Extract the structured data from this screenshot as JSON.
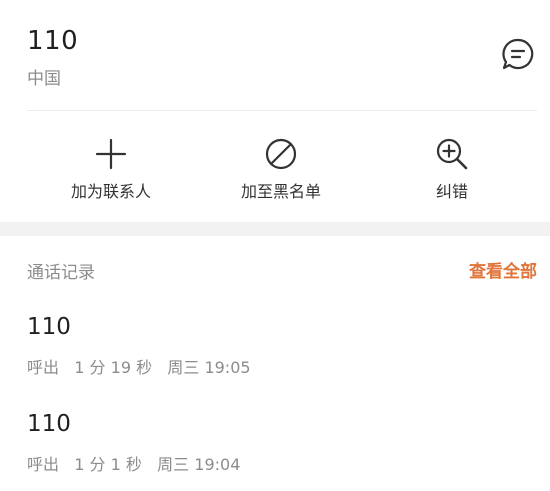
{
  "contact": {
    "number": "110",
    "region": "中国"
  },
  "icons": {
    "message": "message-icon",
    "add_contact": "plus-icon",
    "block": "block-icon",
    "correct": "zoom-in-icon"
  },
  "actions": [
    {
      "label": "加为联系人"
    },
    {
      "label": "加至黑名单"
    },
    {
      "label": "纠错"
    }
  ],
  "call_log": {
    "title": "通话记录",
    "view_all": "查看全部",
    "accent_color": "#e0743a",
    "items": [
      {
        "number": "110",
        "direction": "呼出",
        "duration": "1 分 19 秒",
        "time": "周三 19:05"
      },
      {
        "number": "110",
        "direction": "呼出",
        "duration": "1 分 1 秒",
        "time": "周三 19:04"
      }
    ]
  }
}
